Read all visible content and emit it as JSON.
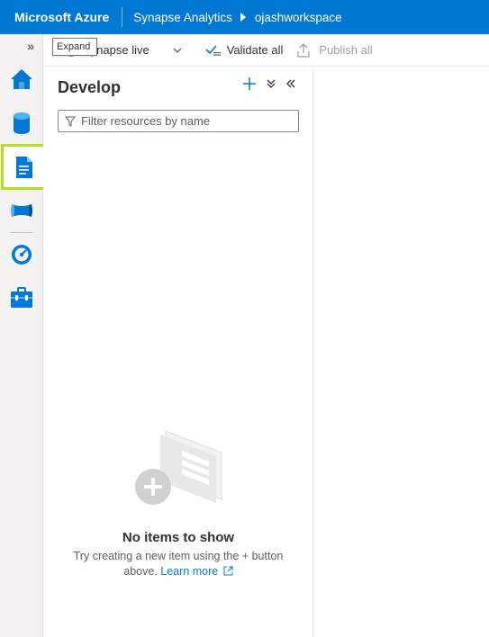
{
  "header": {
    "brand": "Microsoft Azure",
    "breadcrumb_service": "Synapse Analytics",
    "breadcrumb_workspace": "ojashworkspace"
  },
  "rail": {
    "expand_tooltip": "Expand",
    "items": [
      {
        "icon": "home-icon"
      },
      {
        "icon": "data-icon"
      },
      {
        "icon": "develop-icon",
        "selected": true
      },
      {
        "icon": "integrate-icon"
      },
      {
        "icon": "monitor-icon"
      },
      {
        "icon": "manage-icon"
      }
    ]
  },
  "commandbar": {
    "live_mode": "Synapse live",
    "validate": "Validate all",
    "publish": "Publish all"
  },
  "develop": {
    "title": "Develop",
    "filter_placeholder": "Filter resources by name",
    "empty_title": "No items to show",
    "empty_desc": "Try creating a new item using the + button above.",
    "learn_more": "Learn more"
  },
  "colors": {
    "header": "#0078d4",
    "accent": "#0078d4",
    "selection_highlight": "#b4dc2b"
  }
}
